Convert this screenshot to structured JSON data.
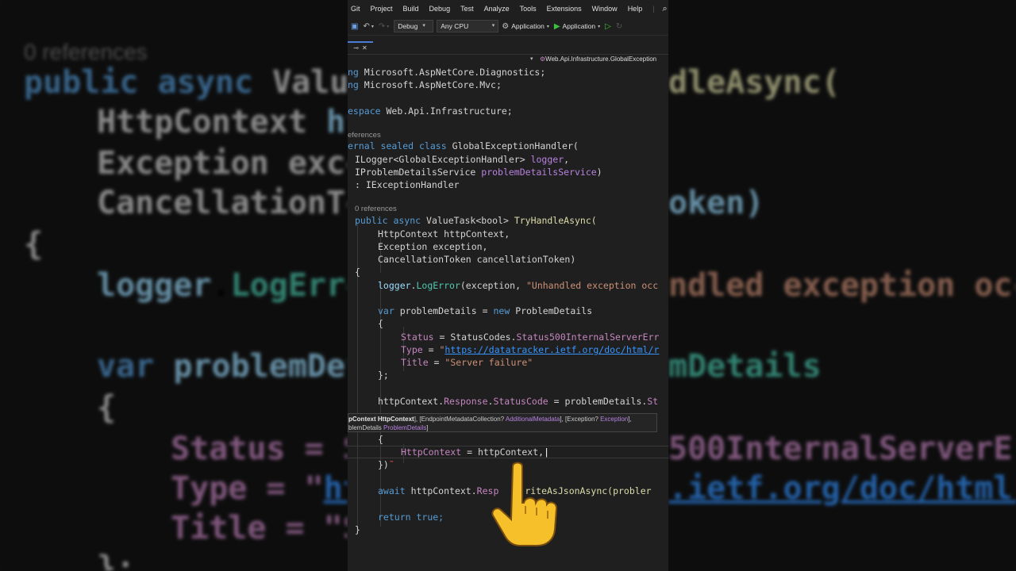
{
  "menu": {
    "items": [
      "Git",
      "Project",
      "Build",
      "Debug",
      "Test",
      "Analyze",
      "Tools",
      "Extensions",
      "Window",
      "Help"
    ]
  },
  "toolbar": {
    "config": "Debug",
    "platform": "Any CPU",
    "startup_project": "Application",
    "run_target": "Application"
  },
  "navigation": {
    "breadcrumb": "Web.Api.Infrastructure.GlobalException"
  },
  "code": {
    "using1_kw": "ng",
    "using1_ns": "Microsoft.AspNetCore.Diagnostics;",
    "using2_kw": "ng",
    "using2_ns": "Microsoft.AspNetCore.Mvc;",
    "ns_kw": "espace",
    "ns_name": "Web.Api.Infrastructure;",
    "refs_class": "eferences",
    "class_kw": "ernal sealed class",
    "class_name": "GlobalExceptionHandler",
    "ctor_p1_type": "ILogger<GlobalExceptionHandler>",
    "ctor_p1_name": "logger",
    "ctor_p2_type": "IProblemDetailsService",
    "ctor_p2_name": "problemDetailsService",
    "base": ": IExceptionHandler",
    "refs_method": "0 references",
    "method_mods": "public async",
    "method_ret": "ValueTask<bool>",
    "method_name": "TryHandleAsync(",
    "arg1_type": "HttpContext",
    "arg1_name": "httpContext,",
    "arg2_type": "Exception",
    "arg2_name": "exception,",
    "arg3_type": "CancellationToken",
    "arg3_name": "cancellationToken)",
    "brace_open": "{",
    "log_obj": "logger",
    "log_method": "LogError",
    "log_args_a": "(exception,",
    "log_args_str": "\"Unhandled exception occ",
    "var_kw": "var",
    "var_name": "problemDetails",
    "var_eq": "=",
    "new_kw": "new",
    "pd_type": "ProblemDetails",
    "init_open": "{",
    "status_prop": "Status",
    "status_val_a": "StatusCodes",
    "status_val_b": "Status500InternalServerErr",
    "type_prop": "Type",
    "type_str_a": "\"",
    "type_url": "https://datatracker.ietf.org/doc/html/r",
    "title_prop": "Title",
    "title_str": "\"Server failure\"",
    "init_close": "};",
    "resp_a": "httpContext",
    "resp_b": "Response",
    "resp_c": "StatusCode",
    "resp_d": "problemDetails",
    "resp_e": "St",
    "brace2": "{",
    "httpctx_prop": "HttpContext",
    "httpctx_eq": "=",
    "httpctx_val": "httpContext,",
    "close_paren": "})",
    "await_kw": "await",
    "await_a": "httpContext",
    "await_b": "Resp",
    "await_c": "riteAsJsonAsync(probler",
    "return_kw": "return",
    "return_val": "true;",
    "brace_close": "}"
  },
  "signature_help": {
    "l1_a": "pContext",
    "l1_b": "HttpContext",
    "l1_c": "], [EndpointMetadataCollection?",
    "l1_d": "AdditionalMetadata",
    "l1_e": "], [Exception?",
    "l1_f": "Exception",
    "l1_g": "],",
    "l2_a": "blemDetails",
    "l2_b": "ProblemDetails",
    "l2_c": "]"
  },
  "background": {
    "left": {
      "refs": "0 references",
      "l1_kw": "public async",
      "l1_rest": "Value",
      "l2_type": "HttpContext",
      "l2_rest": "ht",
      "l3": "Exception exce",
      "l4": "CancellationTo",
      "l5": "{",
      "l6_a": "logger",
      "l6_b": "LogErro",
      "l7_kw": "var",
      "l7_rest": "problemDet",
      "l8": "{",
      "l9": "Status = S",
      "l10_a": "Type = \"",
      "l10_b": "ht",
      "l11": "Title = \"S",
      "l12": "};"
    },
    "right": {
      "r1": "dleAsync(",
      "r2": "oken)",
      "r3": "ndled exception occ",
      "r4": "mDetails",
      "r5": "500InternalServerErr",
      "r6": ".ietf.org/doc/html/r"
    }
  },
  "colors": {
    "editor_bg": "#1f1f1f",
    "keyword": "#569cd6",
    "type": "#4ec9b0",
    "method": "#dcdcaa",
    "property": "#c586c0",
    "string": "#ce9178",
    "url": "#3794ff"
  }
}
